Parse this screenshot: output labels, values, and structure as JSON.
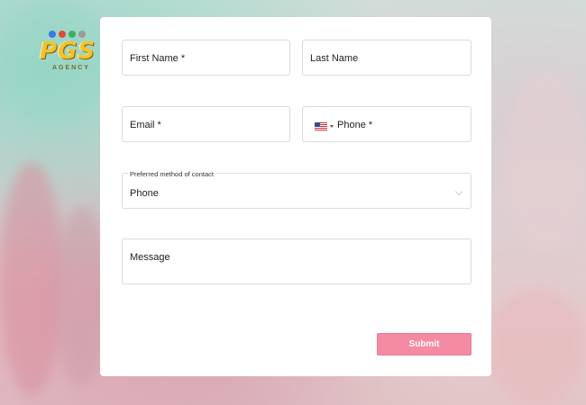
{
  "logo": {
    "text": "PGS",
    "subtext": "AGENCY",
    "dot_colors": [
      "#3a7be0",
      "#e04a3a",
      "#3ab060",
      "#9a9a9a"
    ]
  },
  "form": {
    "first_name": {
      "placeholder": "First Name *"
    },
    "last_name": {
      "placeholder": "Last Name"
    },
    "email": {
      "placeholder": "Email  *"
    },
    "phone": {
      "placeholder": "Phone *",
      "country_icon": "us-flag-icon"
    },
    "contact_method": {
      "label": "Preferred method of contact",
      "value": "Phone"
    },
    "message": {
      "placeholder": "Message"
    },
    "submit_label": "Submit"
  },
  "colors": {
    "submit_bg": "#f58aa3",
    "card_bg": "#ffffff",
    "field_border": "#dcdcdc"
  }
}
